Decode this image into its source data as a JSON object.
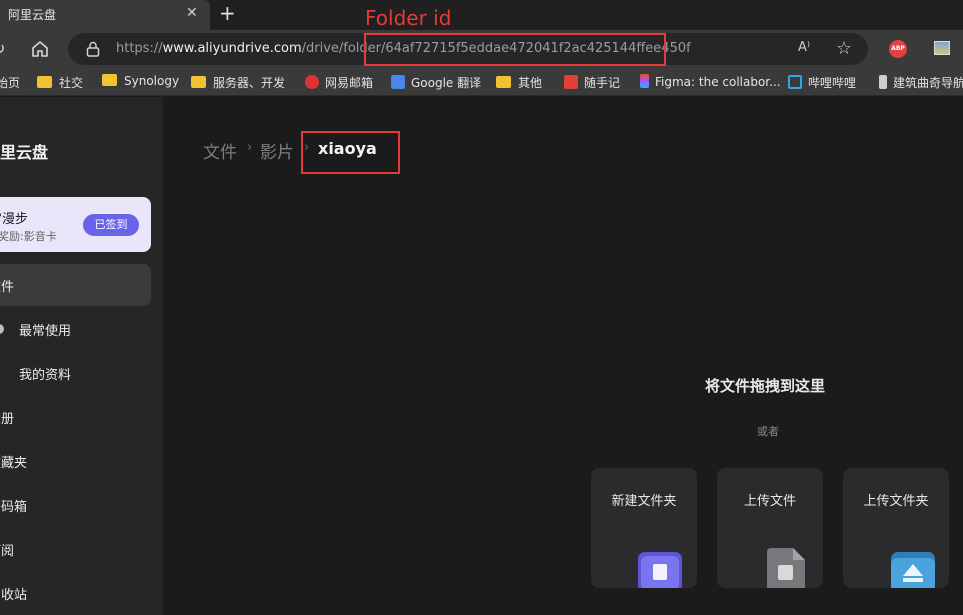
{
  "tab": {
    "title": "阿里云盘",
    "close_glyph": "✕",
    "new_tab_glyph": "+"
  },
  "navbar": {
    "url_prefix": "https://",
    "url_domain": "www.aliyundrive.com",
    "url_path": "/drive/folder/64af72715f5eddae472041f2ac425144ffee450f",
    "read_aloud_glyph": "A⁾",
    "abp_label": "ABP"
  },
  "bookmarks": [
    {
      "label": "始页",
      "icon": "page-icon"
    },
    {
      "label": "社交",
      "icon": "folder-icon"
    },
    {
      "label": "Synology",
      "icon": "folder-icon"
    },
    {
      "label": "服务器、开发",
      "icon": "folder-icon"
    },
    {
      "label": "网易邮箱",
      "icon": "netease-icon"
    },
    {
      "label": "Google 翻译",
      "icon": "google-translate-icon"
    },
    {
      "label": "其他",
      "icon": "folder-icon"
    },
    {
      "label": "随手记",
      "icon": "suishouji-icon"
    },
    {
      "label": "Figma: the collabor...",
      "icon": "figma-icon"
    },
    {
      "label": "哔哩哔哩",
      "icon": "bilibili-icon"
    },
    {
      "label": "建筑曲奇导航",
      "icon": "site-icon"
    }
  ],
  "sidebar": {
    "logo": "阿里云盘",
    "card_title": "宇宙漫步",
    "card_sub": "今日奖励:影音卡",
    "card_button": "已签到",
    "items": [
      {
        "label": "文件"
      },
      {
        "label": "最常使用"
      },
      {
        "label": "我的资料"
      },
      {
        "label": "相册"
      },
      {
        "label": "收藏夹"
      },
      {
        "label": "密码箱"
      },
      {
        "label": "订阅"
      },
      {
        "label": "回收站"
      }
    ]
  },
  "breadcrumb": {
    "root": "文件",
    "middle": "影片",
    "current": "xiaoya",
    "separator": "›"
  },
  "dropzone": {
    "title": "将文件拖拽到这里",
    "or": "或者",
    "actions": [
      {
        "label": "新建文件夹",
        "icon": "new-folder-icon"
      },
      {
        "label": "上传文件",
        "icon": "upload-file-icon"
      },
      {
        "label": "上传文件夹",
        "icon": "upload-folder-icon"
      }
    ]
  },
  "annotation": {
    "label": "Folder id",
    "color": "#e53a3a"
  }
}
